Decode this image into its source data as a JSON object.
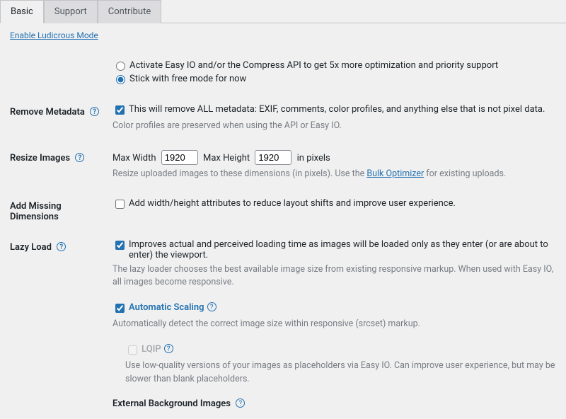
{
  "tabs": {
    "basic": "Basic",
    "support": "Support",
    "contribute": "Contribute"
  },
  "ludicrous_link": "Enable Ludicrous Mode",
  "optimization_mode": {
    "option_activate": "Activate Easy IO and/or the Compress API to get 5x more optimization and priority support",
    "option_free": "Stick with free mode for now"
  },
  "remove_metadata": {
    "heading": "Remove Metadata",
    "label": "This will remove ALL metadata: EXIF, comments, color profiles, and anything else that is not pixel data.",
    "desc": "Color profiles are preserved when using the API or Easy IO."
  },
  "resize": {
    "heading": "Resize Images",
    "max_width_label": "Max Width",
    "max_width_value": "1920",
    "max_height_label": "Max Height",
    "max_height_value": "1920",
    "unit": "in pixels",
    "desc_before": "Resize uploaded images to these dimensions (in pixels). Use the ",
    "bulk_link": "Bulk Optimizer",
    "desc_after": " for existing uploads."
  },
  "dimensions": {
    "heading": "Add Missing Dimensions",
    "label": "Add width/height attributes to reduce layout shifts and improve user experience."
  },
  "lazy": {
    "heading": "Lazy Load",
    "label": "Improves actual and perceived loading time as images will be loaded only as they enter (or are about to enter) the viewport.",
    "desc": "The lazy loader chooses the best available image size from existing responsive markup. When used with Easy IO, all images become responsive.",
    "auto_scaling_label": "Automatic Scaling",
    "auto_scaling_desc": "Automatically detect the correct image size within responsive (srcset) markup.",
    "lqip_label": "LQIP",
    "lqip_desc": "Use low-quality versions of your images as placeholders via Easy IO. Can improve user experience, but may be slower than blank placeholders.",
    "external_bg": "External Background Images"
  }
}
